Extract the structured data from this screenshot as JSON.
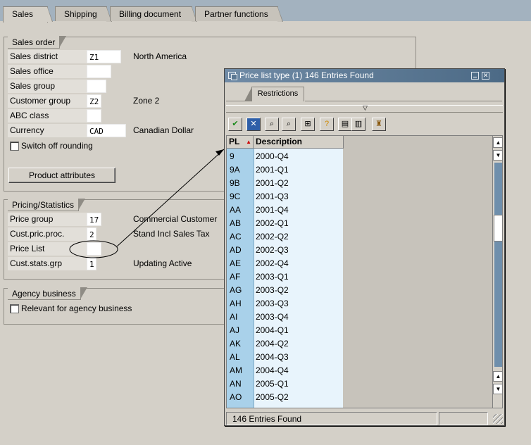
{
  "tabs": [
    "Sales",
    "Shipping",
    "Billing document",
    "Partner functions"
  ],
  "sales_order": {
    "title": "Sales order",
    "rows": [
      {
        "label": "Sales district",
        "value": "Z1",
        "text": "North America"
      },
      {
        "label": "Sales office",
        "value": "",
        "text": ""
      },
      {
        "label": "Sales group",
        "value": "",
        "text": ""
      },
      {
        "label": "Customer group",
        "value": "Z2",
        "text": "Zone 2"
      },
      {
        "label": "ABC class",
        "value": "",
        "text": ""
      },
      {
        "label": "Currency",
        "value": "CAD",
        "text": "Canadian Dollar"
      }
    ],
    "checkbox_label": "Switch off rounding",
    "button_label": "Product attributes"
  },
  "pricing": {
    "title": "Pricing/Statistics",
    "rows": [
      {
        "label": "Price group",
        "value": "17",
        "text": "Commercial Customer"
      },
      {
        "label": "Cust.pric.proc.",
        "value": "2",
        "text": "Stand Incl Sales Tax"
      },
      {
        "label": "Price List",
        "value": "",
        "text": ""
      },
      {
        "label": "Cust.stats.grp",
        "value": "1",
        "text": "Updating Active"
      }
    ]
  },
  "agency": {
    "title": "Agency business",
    "checkbox_label": "Relevant for agency business"
  },
  "popup": {
    "title": "Price list type (1)  146 Entries Found",
    "restrictions_tab": "Restrictions",
    "columns": [
      "PL",
      "Description"
    ],
    "rows": [
      [
        "9",
        "2000-Q4"
      ],
      [
        "9A",
        "2001-Q1"
      ],
      [
        "9B",
        "2001-Q2"
      ],
      [
        "9C",
        "2001-Q3"
      ],
      [
        "AA",
        "2001-Q4"
      ],
      [
        "AB",
        "2002-Q1"
      ],
      [
        "AC",
        "2002-Q2"
      ],
      [
        "AD",
        "2002-Q3"
      ],
      [
        "AE",
        "2002-Q4"
      ],
      [
        "AF",
        "2003-Q1"
      ],
      [
        "AG",
        "2003-Q2"
      ],
      [
        "AH",
        "2003-Q3"
      ],
      [
        "AI",
        "2003-Q4"
      ],
      [
        "AJ",
        "2004-Q1"
      ],
      [
        "AK",
        "2004-Q2"
      ],
      [
        "AL",
        "2004-Q3"
      ],
      [
        "AM",
        "2004-Q4"
      ],
      [
        "AN",
        "2005-Q1"
      ],
      [
        "AO",
        "2005-Q2"
      ]
    ],
    "status": "146 Entries Found",
    "toolbar_icons": [
      "check-icon",
      "cancel-icon",
      "find-icon",
      "find-next-icon",
      "tree-icon",
      "help-icon",
      "print-icon",
      "copy-icon",
      "personal-list-icon"
    ]
  },
  "colors": {
    "window_bg": "#d4d0c8",
    "title_bar": "#5a7792",
    "pl_column": "#a9d1ea",
    "desc_column": "#e8f4fc",
    "scrollbar_track": "#6f8fac"
  }
}
